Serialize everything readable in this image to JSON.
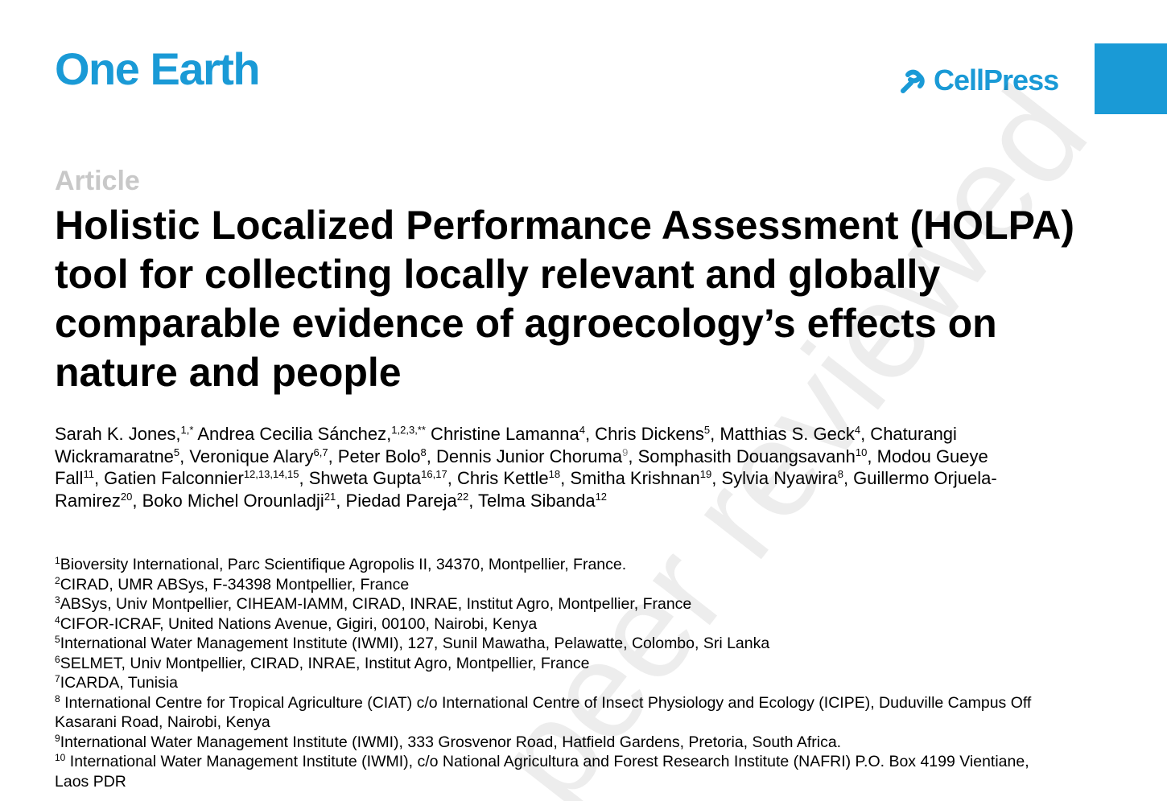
{
  "header": {
    "journal": "One Earth",
    "publisher": "CellPress",
    "logo_color": "#1a9ad6"
  },
  "article_label": "Article",
  "title": "Holistic Localized Performance Assessment (HOLPA) tool for collecting locally relevant and globally comparable evidence of agroecology’s effects on nature and people",
  "authors": {
    "items": [
      {
        "name": "Sarah K. Jones,",
        "sup": "1,*"
      },
      {
        "name": " Andrea Cecilia Sánchez,",
        "sup": "1,2,3,**"
      },
      {
        "name": " Christine Lamanna",
        "sup": "4"
      },
      {
        "name": ", Chris Dickens",
        "sup": "5"
      },
      {
        "name": ", Matthias S. Geck",
        "sup": "4"
      },
      {
        "name": ", Chaturangi Wickramaratne",
        "sup": "5"
      },
      {
        "name": ", Veronique Alary",
        "sup": "6,7"
      },
      {
        "name": ", Peter Bolo",
        "sup": "8"
      },
      {
        "name": ", Dennis Junior Choruma",
        "sup": "9"
      },
      {
        "name": ", Somphasith Douangsavanh",
        "sup": "10"
      },
      {
        "name": ", Modou Gueye Fall",
        "sup": "11"
      },
      {
        "name": ", Gatien Falconnier",
        "sup": "12,13,14,15"
      },
      {
        "name": ", Shweta Gupta",
        "sup": "16,17"
      },
      {
        "name": ", Chris Kettle",
        "sup": "18"
      },
      {
        "name": ", Smitha Krishnan",
        "sup": "19"
      },
      {
        "name": ", Sylvia Nyawira",
        "sup": "8"
      },
      {
        "name": ", Guillermo Orjuela-Ramirez",
        "sup": "20"
      },
      {
        "name": ", Boko Michel Orounladji",
        "sup": "21"
      },
      {
        "name": ", Piedad Pareja",
        "sup": "22"
      },
      {
        "name": ", Telma Sibanda",
        "sup": "12"
      }
    ]
  },
  "affiliations": [
    {
      "num": "1",
      "text": "Bioversity International, Parc Scientifique Agropolis II, 34370, Montpellier, France."
    },
    {
      "num": "2",
      "text": "CIRAD, UMR ABSys, F-34398 Montpellier, France"
    },
    {
      "num": "3",
      "text": "ABSys, Univ Montpellier, CIHEAM-IAMM, CIRAD, INRAE, Institut Agro, Montpellier, France"
    },
    {
      "num": "4",
      "text": "CIFOR-ICRAF, United Nations Avenue, Gigiri, 00100, Nairobi, Kenya"
    },
    {
      "num": "5",
      "text": "International Water Management Institute (IWMI), 127, Sunil Mawatha, Pelawatte, Colombo, Sri Lanka"
    },
    {
      "num": "6",
      "text": "SELMET, Univ Montpellier, CIRAD, INRAE, Institut Agro, Montpellier, France"
    },
    {
      "num": "7",
      "text": "ICARDA, Tunisia"
    },
    {
      "num": "8",
      "text": " International Centre for Tropical Agriculture (CIAT) c/o International Centre of Insect Physiology and Ecology (ICIPE), Duduville Campus Off Kasarani Road, Nairobi, Kenya"
    },
    {
      "num": "9",
      "text": "International Water Management Institute (IWMI), 333 Grosvenor Road, Hatfield Gardens, Pretoria, South Africa."
    },
    {
      "num": "10",
      "text": " International Water Management Institute (IWMI), c/o National Agricultura and Forest Research Institute (NAFRI) P.O. Box 4199 Vientiane, Laos PDR"
    }
  ],
  "watermark": "peer reviewed"
}
